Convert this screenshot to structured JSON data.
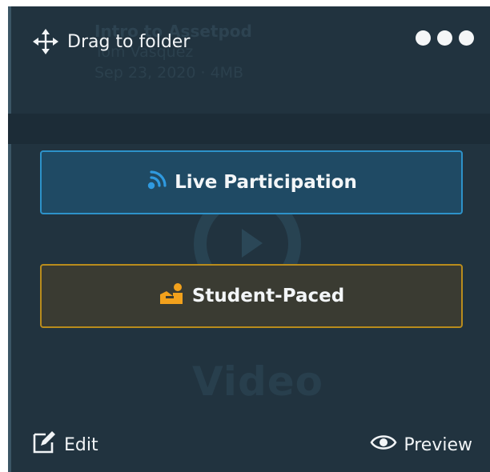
{
  "card": {
    "drag_label": "Drag to folder",
    "more_icon": "more-horizontal-icon"
  },
  "background": {
    "title": "Intro to Assetpod",
    "subtitle_1": "Tom Vasquez",
    "subtitle_2": "Sep 23, 2020 · 4MB",
    "type_label": "Video"
  },
  "actions": {
    "live_label": "Live Participation",
    "live_icon": "broadcast-icon",
    "paced_label": "Student-Paced",
    "paced_icon": "student-paced-icon"
  },
  "footer": {
    "edit_label": "Edit",
    "edit_icon": "edit-icon",
    "preview_label": "Preview",
    "preview_icon": "eye-icon"
  },
  "colors": {
    "card_bg": "#21333f",
    "live_border": "#2d92c9",
    "paced_border": "#b98c1c",
    "live_icon": "#2f9ae0",
    "paced_icon": "#f2a11c"
  }
}
